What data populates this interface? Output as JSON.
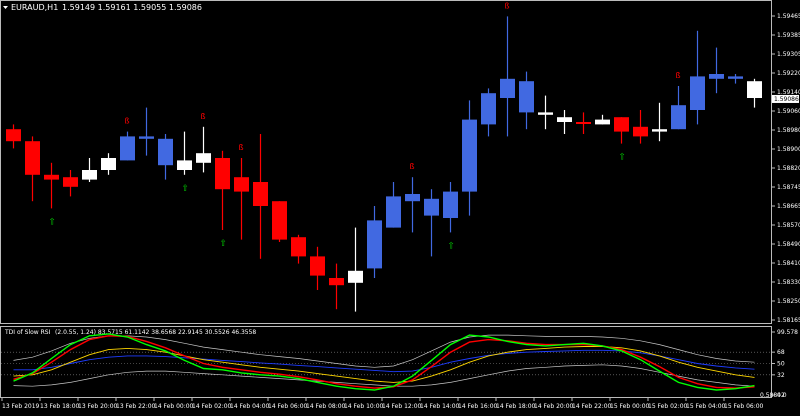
{
  "header": {
    "symbol_tf": "EURAUD,H1",
    "ohlc": "1.59149 1.59161 1.59055 1.59086"
  },
  "indicator": {
    "title": "TDI of Slow RSI",
    "params": "(2.0.55, 1.24) 83.5715 61.1142 38.6568 22.9145 30.5526 46.3558"
  },
  "colors": {
    "background": "#000000",
    "bull": "#4169E1",
    "bear": "#FF0000",
    "doji": "#FFFFFF",
    "arrow_down": "#FF0000",
    "arrow_up": "#00CC00",
    "tdi_green": "#00FF00",
    "tdi_red": "#FF0000",
    "tdi_yellow": "#FFD700",
    "tdi_blue": "#1E3CFF",
    "tdi_band": "#C8C8C8"
  },
  "price_axis": {
    "labels": [
      "1.59465",
      "1.59385",
      "1.59305",
      "1.59220",
      "1.59140",
      "1.59060",
      "1.58980",
      "1.58900",
      "1.58820",
      "1.58745",
      "1.58665",
      "1.58570",
      "1.58490",
      "1.58410",
      "1.58330",
      "1.58250",
      "1.58165"
    ],
    "current_price": "1.59086",
    "ylim": [
      1.58165,
      1.59465
    ]
  },
  "indicator_axis": {
    "labels": [
      "99.578",
      "68",
      "50",
      "32",
      "0.0"
    ],
    "bottom_label": "0.58842"
  },
  "time_axis": {
    "labels": [
      "13 Feb 2019",
      "13 Feb 18:00",
      "13 Feb 20:00",
      "13 Feb 22:00",
      "14 Feb 00:00",
      "14 Feb 02:00",
      "14 Feb 04:00",
      "14 Feb 06:00",
      "14 Feb 08:00",
      "14 Feb 10:00",
      "14 Feb 12:00",
      "14 Feb 14:00",
      "14 Feb 16:00",
      "14 Feb 18:00",
      "14 Feb 20:00",
      "14 Feb 22:00",
      "15 Feb 00:00",
      "15 Feb 02:00",
      "15 Feb 04:00",
      "15 Feb 06:00"
    ]
  },
  "arrows": {
    "down_glyph": "ß",
    "up_glyph": "⇧"
  },
  "chart_data": {
    "type": "candlestick",
    "ylim": [
      1.58165,
      1.59465
    ],
    "candles": [
      {
        "o": 1.5896,
        "h": 1.5898,
        "l": 1.5888,
        "c": 1.5891,
        "kind": "bear"
      },
      {
        "o": 1.5891,
        "h": 1.5893,
        "l": 1.5866,
        "c": 1.5877,
        "kind": "bear"
      },
      {
        "o": 1.5877,
        "h": 1.5882,
        "l": 1.5863,
        "c": 1.5875,
        "kind": "bear"
      },
      {
        "o": 1.5876,
        "h": 1.5879,
        "l": 1.5868,
        "c": 1.5872,
        "kind": "bear"
      },
      {
        "o": 1.5875,
        "h": 1.5884,
        "l": 1.5874,
        "c": 1.5879,
        "kind": "doji"
      },
      {
        "o": 1.5879,
        "h": 1.5886,
        "l": 1.5877,
        "c": 1.5884,
        "kind": "doji"
      },
      {
        "o": 1.5883,
        "h": 1.5895,
        "l": 1.5883,
        "c": 1.5893,
        "kind": "bull"
      },
      {
        "o": 1.5893,
        "h": 1.5905,
        "l": 1.5885,
        "c": 1.5892,
        "kind": "bull"
      },
      {
        "o": 1.5892,
        "h": 1.5894,
        "l": 1.5875,
        "c": 1.5881,
        "kind": "bull"
      },
      {
        "o": 1.5883,
        "h": 1.5895,
        "l": 1.5877,
        "c": 1.5879,
        "kind": "doji"
      },
      {
        "o": 1.5882,
        "h": 1.5897,
        "l": 1.5878,
        "c": 1.5886,
        "kind": "doji"
      },
      {
        "o": 1.5884,
        "h": 1.5887,
        "l": 1.5854,
        "c": 1.5871,
        "kind": "bear"
      },
      {
        "o": 1.5876,
        "h": 1.5884,
        "l": 1.585,
        "c": 1.587,
        "kind": "bear"
      },
      {
        "o": 1.5874,
        "h": 1.5894,
        "l": 1.5842,
        "c": 1.5864,
        "kind": "bear"
      },
      {
        "o": 1.5866,
        "h": 1.5866,
        "l": 1.5849,
        "c": 1.585,
        "kind": "bear"
      },
      {
        "o": 1.5851,
        "h": 1.5852,
        "l": 1.584,
        "c": 1.5843,
        "kind": "bear"
      },
      {
        "o": 1.5843,
        "h": 1.5847,
        "l": 1.5829,
        "c": 1.5835,
        "kind": "bear"
      },
      {
        "o": 1.5834,
        "h": 1.584,
        "l": 1.5821,
        "c": 1.5831,
        "kind": "bear"
      },
      {
        "o": 1.5832,
        "h": 1.5855,
        "l": 1.582,
        "c": 1.5837,
        "kind": "doji"
      },
      {
        "o": 1.5838,
        "h": 1.5864,
        "l": 1.5834,
        "c": 1.5858,
        "kind": "bull"
      },
      {
        "o": 1.5855,
        "h": 1.5874,
        "l": 1.5855,
        "c": 1.5868,
        "kind": "bull"
      },
      {
        "o": 1.5869,
        "h": 1.5876,
        "l": 1.5853,
        "c": 1.5866,
        "kind": "bull"
      },
      {
        "o": 1.5867,
        "h": 1.5871,
        "l": 1.5843,
        "c": 1.586,
        "kind": "bull"
      },
      {
        "o": 1.5859,
        "h": 1.5874,
        "l": 1.5853,
        "c": 1.587,
        "kind": "bull"
      },
      {
        "o": 1.587,
        "h": 1.5908,
        "l": 1.586,
        "c": 1.59,
        "kind": "bull"
      },
      {
        "o": 1.5898,
        "h": 1.5913,
        "l": 1.5893,
        "c": 1.5911,
        "kind": "bull"
      },
      {
        "o": 1.5909,
        "h": 1.5943,
        "l": 1.5893,
        "c": 1.5917,
        "kind": "bull"
      },
      {
        "o": 1.5916,
        "h": 1.592,
        "l": 1.5896,
        "c": 1.5903,
        "kind": "bull"
      },
      {
        "o": 1.5902,
        "h": 1.591,
        "l": 1.5896,
        "c": 1.5903,
        "kind": "doji"
      },
      {
        "o": 1.5901,
        "h": 1.5904,
        "l": 1.5894,
        "c": 1.5899,
        "kind": "doji"
      },
      {
        "o": 1.5899,
        "h": 1.5903,
        "l": 1.5894,
        "c": 1.5899,
        "kind": "bear"
      },
      {
        "o": 1.59,
        "h": 1.5902,
        "l": 1.5898,
        "c": 1.5898,
        "kind": "doji"
      },
      {
        "o": 1.5901,
        "h": 1.5901,
        "l": 1.589,
        "c": 1.5895,
        "kind": "bear"
      },
      {
        "o": 1.5897,
        "h": 1.5904,
        "l": 1.589,
        "c": 1.5893,
        "kind": "bear"
      },
      {
        "o": 1.5895,
        "h": 1.5907,
        "l": 1.5891,
        "c": 1.5896,
        "kind": "doji"
      },
      {
        "o": 1.5896,
        "h": 1.5914,
        "l": 1.5896,
        "c": 1.5906,
        "kind": "bull"
      },
      {
        "o": 1.5904,
        "h": 1.5937,
        "l": 1.5898,
        "c": 1.5918,
        "kind": "bull"
      },
      {
        "o": 1.5917,
        "h": 1.593,
        "l": 1.5911,
        "c": 1.5919,
        "kind": "bull"
      },
      {
        "o": 1.5918,
        "h": 1.5919,
        "l": 1.5915,
        "c": 1.5917,
        "kind": "bull"
      },
      {
        "o": 1.5916,
        "h": 1.5917,
        "l": 1.5905,
        "c": 1.5909,
        "kind": "doji"
      }
    ],
    "down_arrow_bars": [
      6,
      10,
      12,
      21,
      26,
      35
    ],
    "up_arrow_bars": [
      2,
      9,
      11,
      23,
      32
    ],
    "tdi_lines_note": "TDI indicator subwindow series (approximate)",
    "tdi": {
      "ylim": [
        0,
        100
      ],
      "levels": [
        68,
        50,
        32
      ],
      "green": [
        22,
        35,
        58,
        80,
        94,
        97,
        92,
        80,
        70,
        55,
        42,
        40,
        35,
        32,
        30,
        26,
        20,
        14,
        10,
        8,
        14,
        30,
        55,
        80,
        95,
        92,
        85,
        80,
        78,
        80,
        82,
        78,
        70,
        56,
        38,
        20,
        12,
        8,
        10,
        15
      ],
      "red": [
        25,
        34,
        52,
        72,
        88,
        94,
        93,
        85,
        75,
        62,
        50,
        44,
        40,
        36,
        33,
        29,
        24,
        18,
        14,
        11,
        13,
        24,
        45,
        68,
        84,
        88,
        86,
        82,
        80,
        80,
        80,
        78,
        72,
        60,
        45,
        28,
        18,
        12,
        11,
        13
      ],
      "yellow": [
        30,
        32,
        40,
        52,
        64,
        72,
        74,
        72,
        68,
        62,
        56,
        52,
        48,
        44,
        41,
        38,
        34,
        30,
        26,
        22,
        20,
        22,
        30,
        40,
        52,
        62,
        68,
        72,
        74,
        76,
        77,
        77,
        75,
        70,
        62,
        52,
        44,
        38,
        32,
        28
      ],
      "blue": [
        40,
        40,
        44,
        50,
        56,
        60,
        62,
        62,
        61,
        59,
        57,
        55,
        53,
        51,
        49,
        47,
        45,
        43,
        41,
        39,
        37,
        38,
        44,
        52,
        58,
        63,
        66,
        68,
        69,
        70,
        71,
        71,
        70,
        67,
        62,
        56,
        50,
        46,
        43,
        41
      ],
      "band_upper": [
        55,
        60,
        70,
        82,
        90,
        94,
        94,
        92,
        88,
        82,
        76,
        72,
        68,
        64,
        61,
        58,
        54,
        50,
        46,
        44,
        46,
        56,
        70,
        84,
        92,
        95,
        95,
        94,
        93,
        93,
        93,
        92,
        90,
        86,
        80,
        72,
        64,
        58,
        54,
        52
      ],
      "band_lower": [
        15,
        14,
        16,
        20,
        26,
        32,
        36,
        38,
        38,
        36,
        34,
        32,
        30,
        28,
        26,
        24,
        22,
        20,
        18,
        16,
        14,
        14,
        16,
        20,
        26,
        32,
        38,
        42,
        44,
        46,
        47,
        48,
        46,
        42,
        36,
        30,
        24,
        20,
        16,
        14
      ]
    }
  }
}
